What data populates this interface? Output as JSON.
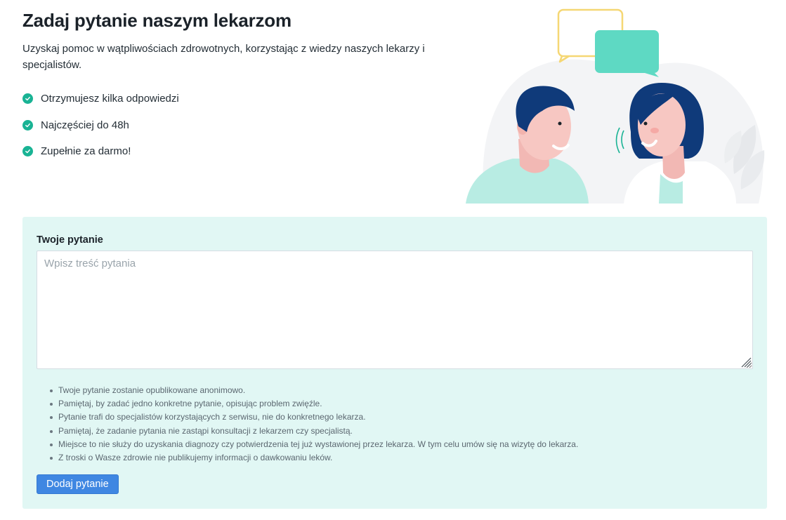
{
  "hero": {
    "title": "Zadaj pytanie naszym lekarzom",
    "lead": "Uzyskaj pomoc w wątpliwościach zdrowotnych, korzystając z wiedzy naszych lekarzy i specjalistów.",
    "benefits": [
      "Otrzymujesz kilka odpowiedzi",
      "Najczęściej do 48h",
      "Zupełnie za darmo!"
    ]
  },
  "form": {
    "label": "Twoje pytanie",
    "placeholder": "Wpisz treść pytania",
    "value": "",
    "tips": [
      "Twoje pytanie zostanie opublikowane anonimowo.",
      "Pamiętaj, by zadać jedno konkretne pytanie, opisując problem zwięźle.",
      "Pytanie trafi do specjalistów korzystających z serwisu, nie do konkretnego lekarza.",
      "Pamiętaj, że zadanie pytania nie zastąpi konsultacji z lekarzem czy specjalistą.",
      "Miejsce to nie służy do uzyskania diagnozy czy potwierdzenia tej już wystawionej przez lekarza. W tym celu umów się na wizytę do lekarza.",
      "Z troski o Wasze zdrowie nie publikujemy informacji o dawkowaniu leków."
    ],
    "submit_label": "Dodaj pytanie"
  },
  "colors": {
    "accent_green": "#19b394",
    "panel_bg": "#e1f7f4",
    "button_blue": "#3f87e2",
    "illustration_navy": "#0f3a7a",
    "illustration_mint": "#5ed9c3",
    "illustration_yellow": "#f5d774"
  },
  "icons": {
    "benefit_icon": "check-circle-icon",
    "resize_icon": "resize-handle-icon"
  }
}
